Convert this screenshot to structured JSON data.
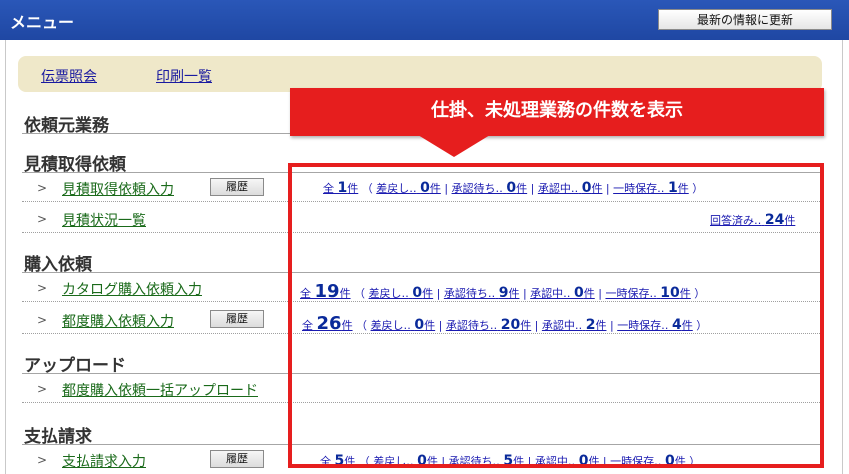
{
  "window": {
    "title": "メニュー",
    "refresh_label": "最新の情報に更新"
  },
  "toplinks": [
    "伝票照会",
    "印刷一覧"
  ],
  "callout": "仕掛、未処理業務の件数を表示",
  "sections": {
    "requester": "依頼元業務",
    "estimate": "見積取得依頼",
    "purchase": "購入依頼",
    "upload": "アップロード",
    "payment": "支払請求"
  },
  "menu": {
    "estimate_entry": "見積取得依頼入力",
    "estimate_status": "見積状況一覧",
    "catalog_entry": "カタログ購入依頼入力",
    "adhoc_entry": "都度購入依頼入力",
    "bulk_upload": "都度購入依頼一括アップロード",
    "payment_entry": "支払請求入力",
    "history_label": "履歴"
  },
  "labels": {
    "total": "全",
    "unit": "件",
    "returned": "差戻し‥",
    "waiting": "承認待ち‥",
    "in_approval": "承認中‥",
    "saved": "一時保存‥",
    "answered": "回答済み‥"
  },
  "counts": {
    "estimate": {
      "total": "1",
      "returned": "0",
      "waiting": "0",
      "in_approval": "0",
      "saved": "1"
    },
    "estimate_answered": "24",
    "catalog": {
      "total": "19",
      "returned": "0",
      "waiting": "9",
      "in_approval": "0",
      "saved": "10"
    },
    "adhoc": {
      "total": "26",
      "returned": "0",
      "waiting": "20",
      "in_approval": "2",
      "saved": "4"
    },
    "payment": {
      "total": "5",
      "returned": "0",
      "waiting": "5",
      "in_approval": "0",
      "saved": "0"
    }
  },
  "colors": {
    "title_bar": "#1f47a3",
    "highlight": "#e61e1e",
    "link": "#1a1ab0",
    "menu_link": "#1a6a1a"
  }
}
